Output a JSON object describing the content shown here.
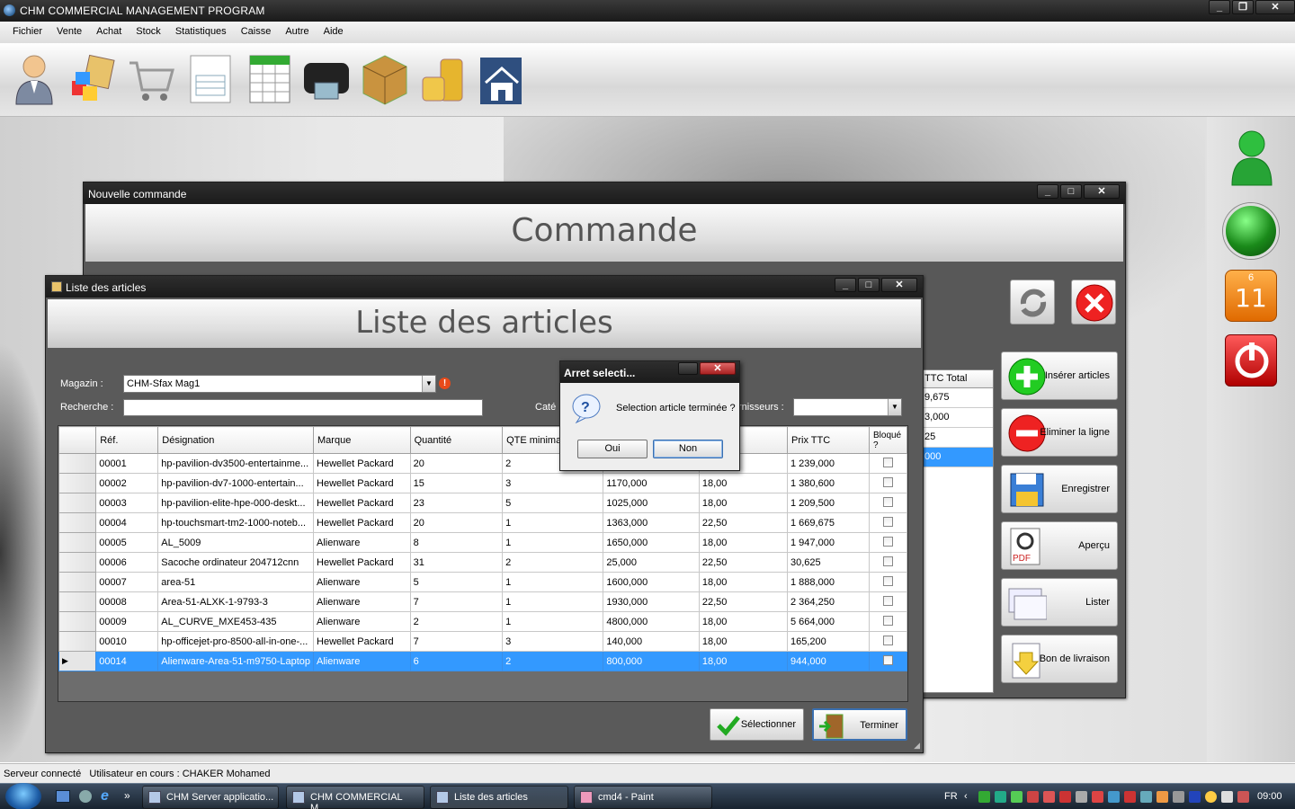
{
  "app": {
    "title": "CHM COMMERCIAL MANAGEMENT PROGRAM"
  },
  "menu": [
    "Fichier",
    "Vente",
    "Achat",
    "Stock",
    "Statistiques",
    "Caisse",
    "Autre",
    "Aide"
  ],
  "toolbar_icons": [
    "user-icon",
    "products-boxes-icon",
    "cart-icon",
    "invoice-icon",
    "spreadsheet-icon",
    "wallet-icon",
    "package-icon",
    "coins-icon",
    "home-icon"
  ],
  "right_panel": {
    "calendar_month": "6",
    "calendar_day": "11"
  },
  "commande_window": {
    "title": "Nouvelle commande",
    "banner": "Commande",
    "grid_header": "TTC Total",
    "grid_rows": [
      "9,675",
      "3,000",
      "25",
      "000"
    ],
    "buttons": {
      "insert": "Insérer articles",
      "delete": "Eliminer la ligne",
      "save": "Enregistrer",
      "preview": "Aperçu",
      "list": "Lister",
      "delivery": "Bon de livraison"
    }
  },
  "list_window": {
    "title": "Liste des articles",
    "banner": "Liste des articles",
    "magazin_label": "Magazin :",
    "magazin_value": "CHM-Sfax Mag1",
    "search_label": "Recherche :",
    "search_value": "",
    "category_label": "Caté",
    "supplier_label": "rnisseurs :",
    "columns": [
      "Réf.",
      "Désignation",
      "Marque",
      "Quantité",
      "QTE minimale",
      "",
      "",
      "Prix TTC",
      "Bloqué ?"
    ],
    "rows": [
      {
        "ref": "00001",
        "des": "hp-pavilion-dv3500-entertainme...",
        "marque": "Hewellet Packard",
        "qte": "20",
        "qmin": "2",
        "pu": "",
        "tva": "",
        "ttc": "1 239,000"
      },
      {
        "ref": "00002",
        "des": "hp-pavilion-dv7-1000-entertain...",
        "marque": "Hewellet Packard",
        "qte": "15",
        "qmin": "3",
        "pu": "1170,000",
        "tva": "18,00",
        "ttc": "1 380,600"
      },
      {
        "ref": "00003",
        "des": "hp-pavilion-elite-hpe-000-deskt...",
        "marque": "Hewellet Packard",
        "qte": "23",
        "qmin": "5",
        "pu": "1025,000",
        "tva": "18,00",
        "ttc": "1 209,500"
      },
      {
        "ref": "00004",
        "des": "hp-touchsmart-tm2-1000-noteb...",
        "marque": "Hewellet Packard",
        "qte": "20",
        "qmin": "1",
        "pu": "1363,000",
        "tva": "22,50",
        "ttc": "1 669,675"
      },
      {
        "ref": "00005",
        "des": "AL_5009",
        "marque": "Alienware",
        "qte": "8",
        "qmin": "1",
        "pu": "1650,000",
        "tva": "18,00",
        "ttc": "1 947,000"
      },
      {
        "ref": "00006",
        "des": "Sacoche ordinateur 204712cnn",
        "marque": "Hewellet Packard",
        "qte": "31",
        "qmin": "2",
        "pu": "25,000",
        "tva": "22,50",
        "ttc": "30,625"
      },
      {
        "ref": "00007",
        "des": "area-51",
        "marque": "Alienware",
        "qte": "5",
        "qmin": "1",
        "pu": "1600,000",
        "tva": "18,00",
        "ttc": "1 888,000"
      },
      {
        "ref": "00008",
        "des": "Area-51-ALXK-1-9793-3",
        "marque": "Alienware",
        "qte": "7",
        "qmin": "1",
        "pu": "1930,000",
        "tva": "22,50",
        "ttc": "2 364,250"
      },
      {
        "ref": "00009",
        "des": "AL_CURVE_MXE453-435",
        "marque": "Alienware",
        "qte": "2",
        "qmin": "1",
        "pu": "4800,000",
        "tva": "18,00",
        "ttc": "5 664,000"
      },
      {
        "ref": "00010",
        "des": "hp-officejet-pro-8500-all-in-one-...",
        "marque": "Hewellet Packard",
        "qte": "7",
        "qmin": "3",
        "pu": "140,000",
        "tva": "18,00",
        "ttc": "165,200"
      },
      {
        "ref": "00014",
        "des": "Alienware-Area-51-m9750-Laptop",
        "marque": "Alienware",
        "qte": "6",
        "qmin": "2",
        "pu": "800,000",
        "tva": "18,00",
        "ttc": "944,000"
      }
    ],
    "select_button": "Sélectionner",
    "finish_button": "Terminer"
  },
  "dialog": {
    "title": "Arret selecti...",
    "message": "Selection article terminée ?",
    "yes": "Oui",
    "no": "Non"
  },
  "status": {
    "text": "Serveur connecté   Utilisateur en cours : CHAKER Mohamed"
  },
  "taskbar": {
    "items": [
      "CHM Server applicatio...",
      "CHM COMMERCIAL M...",
      "Liste des articles",
      "cmd4 - Paint"
    ],
    "quicklaunch_more": "»",
    "lang": "FR",
    "clock": "09:00"
  }
}
